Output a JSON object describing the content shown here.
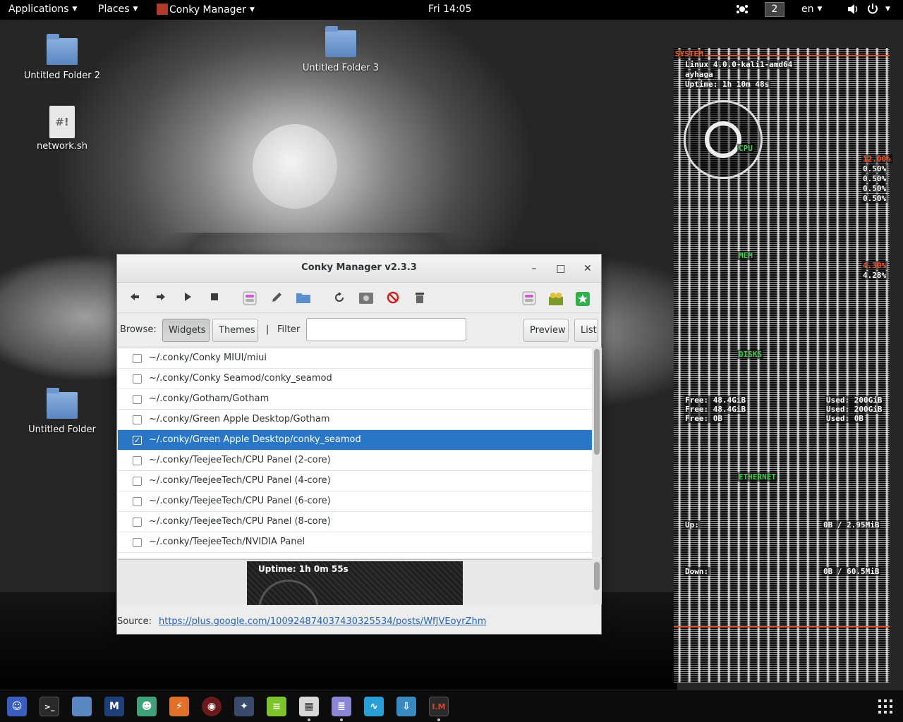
{
  "top_panel": {
    "applications": "Applications",
    "places": "Places",
    "active_app": "Conky Manager",
    "clock": "Fri 14:05",
    "workspace": "2",
    "keyboard_layout": "en"
  },
  "desktop": {
    "icons": [
      {
        "label": "Untitled Folder 2"
      },
      {
        "label": "Untitled Folder 3"
      },
      {
        "label": "network.sh",
        "glyph": "#!"
      },
      {
        "label": "Untitled Folder"
      }
    ]
  },
  "conky_widget": {
    "system_header": "SYSTEM",
    "kernel": "Linux 4.0.0-kali1-amd64",
    "user": "ayhaga",
    "uptime": "Uptime: 1h 10m 48s",
    "cpu_header": "CPU",
    "cpu_values": [
      "12.00%",
      "0.50%",
      "0.50%",
      "0.50%",
      "0.50%"
    ],
    "mem_header": "MEM",
    "mem_values": [
      "4.30%",
      "4.28%"
    ],
    "disks_header": "DISKS",
    "disk_free": [
      "Free: 48.4GiB",
      "Free: 48.4GiB",
      "Free: 0B"
    ],
    "disk_used": [
      "Used: 200GiB",
      "Used: 200GiB",
      "Used: 0B"
    ],
    "ethernet_header": "ETHERNET",
    "up_label": "Up:",
    "up_value": "0B / 2.95MiB",
    "down_label": "Down:",
    "down_value": "0B / 60.5MiB",
    "accent_color": "#ff5522",
    "header_color": "#3fcf4a"
  },
  "window": {
    "title": "Conky Manager v2.3.3",
    "controls": {
      "minimize": "–",
      "maximize": "□",
      "close": "✕"
    },
    "toolbar_icons": [
      "back-icon",
      "forward-icon",
      "play-icon",
      "stop-icon",
      "toggle-icon",
      "edit-icon",
      "folder-icon",
      "refresh-icon",
      "screenshot-icon",
      "kill-icon",
      "delete-icon",
      "settings-toggle-icon",
      "donate-icon",
      "about-star-icon"
    ],
    "browse_label": "Browse:",
    "widgets_button": "Widgets",
    "themes_button": "Themes",
    "separator": "|",
    "filter_label": "Filter",
    "filter_value": "",
    "preview_button": "Preview",
    "list_button": "List",
    "rows": [
      {
        "path": "~/.conky/Conky MIUI/miui",
        "checked": false
      },
      {
        "path": "~/.conky/Conky Seamod/conky_seamod",
        "checked": false
      },
      {
        "path": "~/.conky/Gotham/Gotham",
        "checked": false
      },
      {
        "path": "~/.conky/Green Apple Desktop/Gotham",
        "checked": false
      },
      {
        "path": "~/.conky/Green Apple Desktop/conky_seamod",
        "checked": true
      },
      {
        "path": "~/.conky/TeejeeTech/CPU Panel (2-core)",
        "checked": false
      },
      {
        "path": "~/.conky/TeejeeTech/CPU Panel (4-core)",
        "checked": false
      },
      {
        "path": "~/.conky/TeejeeTech/CPU Panel (6-core)",
        "checked": false
      },
      {
        "path": "~/.conky/TeejeeTech/CPU Panel (8-core)",
        "checked": false
      },
      {
        "path": "~/.conky/TeejeeTech/NVIDIA Panel",
        "checked": false
      }
    ],
    "preview_text": "Uptime: 1h 0m 55s",
    "source_label": "Source:",
    "source_url": "https://plus.google.com/100924874037430325534/posts/WfJVEoyrZhm",
    "selection_color": "#2a76c6"
  },
  "taskbar": {
    "apps": [
      "discord-icon",
      "terminal-icon",
      "files-icon",
      "metasploit-icon",
      "anime-avatar-icon",
      "burp-icon",
      "armitage-icon",
      "maltego-icon",
      "notes-icon",
      "calculator-icon",
      "text-editor-icon",
      "system-monitor-icon",
      "downloads-icon",
      "conky-manager-icon"
    ],
    "conky_manager_glyph": "I.M"
  }
}
